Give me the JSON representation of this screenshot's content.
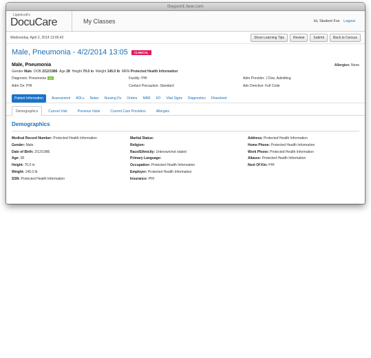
{
  "browser": {
    "url": "thepoint.lww.com"
  },
  "app": {
    "logo_top": "Lippincott's",
    "logo_main": "DocuCare",
    "nav_label": "My Classes",
    "user_greeting": "Hi, Student Fox",
    "logout": "Logout"
  },
  "toolbar": {
    "date": "Wednesday, April 2, 2014 13:06:42",
    "buttons": [
      "Show Learning Tips",
      "Review",
      "Submit",
      "Back to Census"
    ]
  },
  "patient": {
    "title": "Male, Pneumonia - 4/2/2014 13:05",
    "badge": "CLINICAL",
    "name": "Male, Pneumonia",
    "allergies_label": "Allergies:",
    "allergies_value": "None",
    "summary": [
      {
        "label": "Gender",
        "value": "Male"
      },
      {
        "label": "DOB",
        "value": "2/12/1986"
      },
      {
        "label": "Age",
        "value": "28"
      },
      {
        "label": "Height",
        "value": "70.0 in"
      },
      {
        "label": "Weight",
        "value": "145.0 lb"
      },
      {
        "label": "MRN",
        "value": "Protected Health Information"
      }
    ],
    "info_col1": [
      {
        "label": "Diagnosis:",
        "value": "Pneumonia",
        "tag": "Dx"
      },
      {
        "label": "Adm On:",
        "value": "PHI"
      }
    ],
    "info_col2": [
      {
        "label": "Facility:",
        "value": "PHI"
      },
      {
        "label": "Contact Precaution:",
        "value": "Standard"
      }
    ],
    "info_col3": [
      {
        "label": "Adm Provider:",
        "value": "J Doe, Admitting"
      },
      {
        "label": "Adv Directive:",
        "value": "Full Code"
      }
    ]
  },
  "nav_tabs": [
    "Patient Information",
    "Assessment",
    "ADLs",
    "Notes",
    "Nursing Dx",
    "Orders",
    "MAR",
    "I/O",
    "Vital Signs",
    "Diagnostics",
    "Flowsheet"
  ],
  "sub_tabs": [
    "Demographics",
    "Current Visit",
    "Previous Visits",
    "Current Care Providers",
    "Allergies"
  ],
  "section_title": "Demographics",
  "demographics": {
    "col1": [
      {
        "label": "Medical Record Number:",
        "value": "Protected Health Information"
      },
      {
        "label": "Gender:",
        "value": "Male"
      },
      {
        "label": "Date of Birth:",
        "value": "2/12/1986"
      },
      {
        "label": "Age:",
        "value": "28"
      },
      {
        "label": "Height:",
        "value": "70.0 in"
      },
      {
        "label": "Weight:",
        "value": "145.0 lb"
      },
      {
        "label": "SSN:",
        "value": "Protected Health Information"
      }
    ],
    "col2": [
      {
        "label": "Marital Status:",
        "value": ""
      },
      {
        "label": "Religion:",
        "value": ""
      },
      {
        "label": "Race/Ethnicity:",
        "value": "Unknown/not stated"
      },
      {
        "label": "Primary Language:",
        "value": ""
      },
      {
        "label": "Occupation:",
        "value": "Protected Health Information"
      },
      {
        "label": "Employer:",
        "value": "Protected Health Information"
      },
      {
        "label": "Insurance:",
        "value": "PHI"
      }
    ],
    "col3": [
      {
        "label": "Address:",
        "value": "Protected Health Information"
      },
      {
        "label": "Home Phone:",
        "value": "Protected Health Information"
      },
      {
        "label": "Work Phone:",
        "value": "Protected Health Information"
      },
      {
        "label": "Aliases:",
        "value": "Protected Health Information"
      },
      {
        "label": "Next Of Kin:",
        "value": "PHI"
      }
    ]
  },
  "colors": {
    "accent": "#1a6db4",
    "badge": "#e2195d",
    "active_tab": "#1a73c9",
    "dx_tag": "#7cc142"
  }
}
